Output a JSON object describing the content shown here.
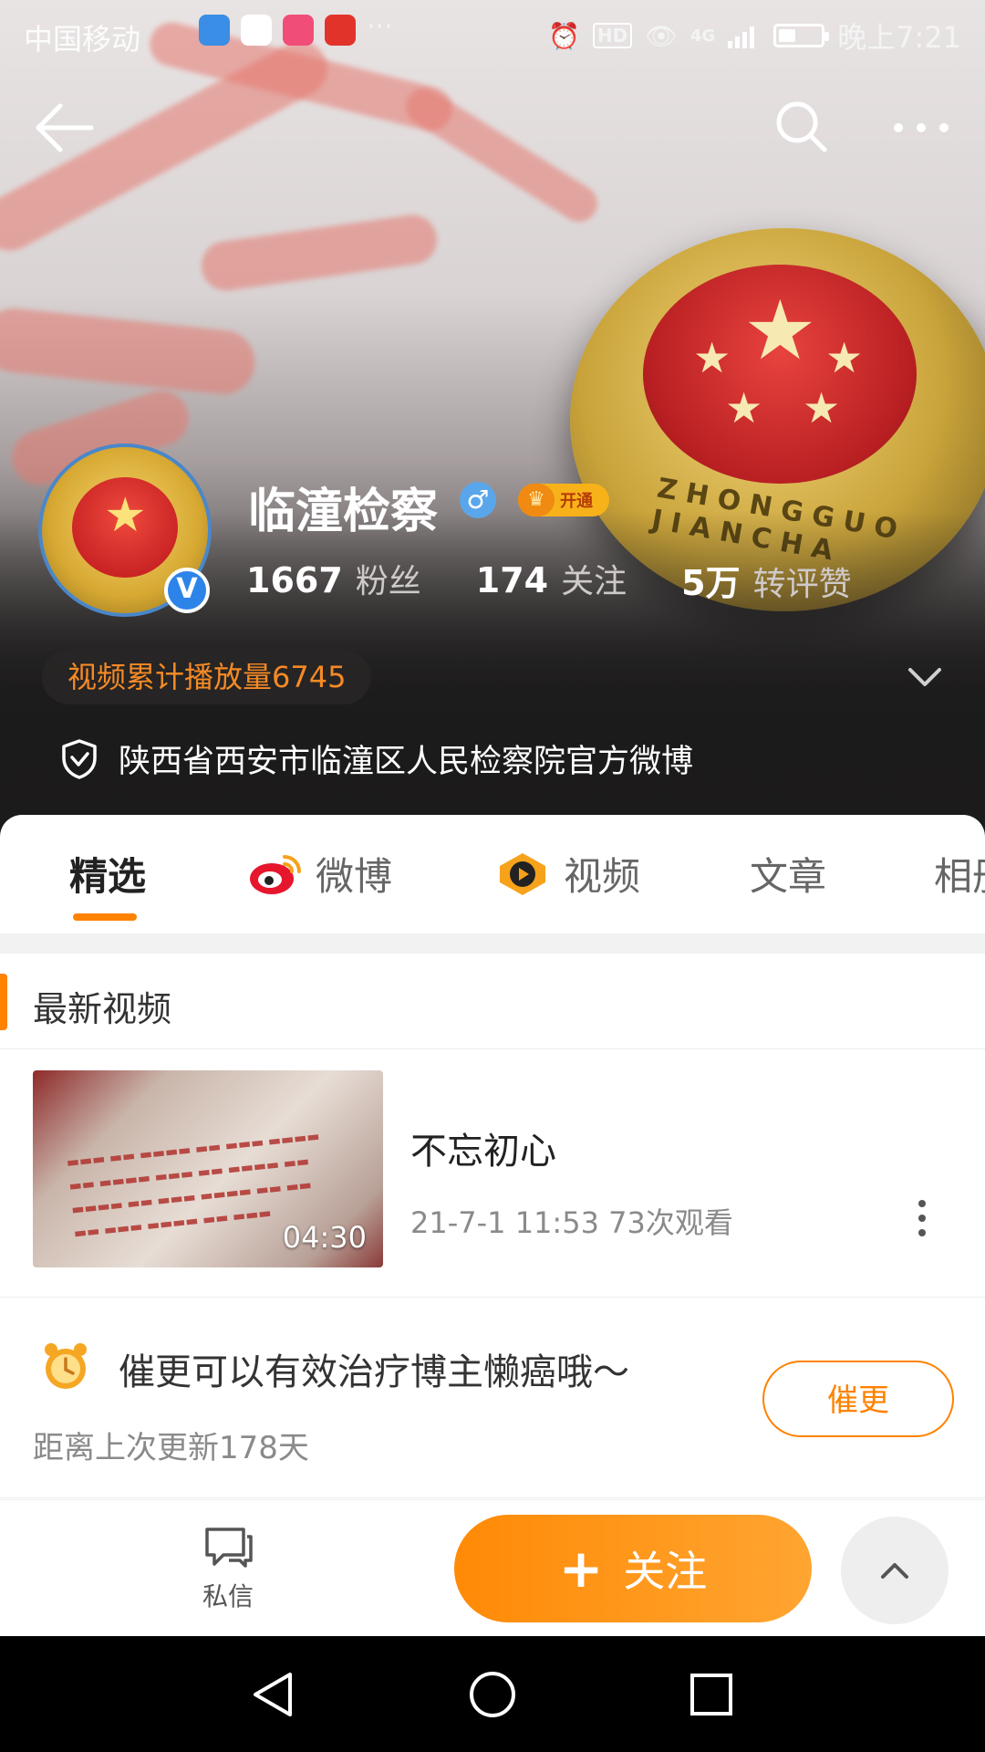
{
  "status_bar": {
    "carrier": "中国移动",
    "time": "晚上7:21",
    "network": "4G",
    "hd": "HD",
    "app_icon_colors": [
      "#3a8ee6",
      "#ffffff",
      "#f04d79",
      "#e2332a"
    ]
  },
  "top_nav": {
    "back_icon": "arrow-left-icon",
    "search_icon": "search-icon",
    "more_icon": "more-dots-icon"
  },
  "profile": {
    "name": "临潼检察",
    "gender_symbol": "♂",
    "verified_symbol": "V",
    "vip_label": "开通",
    "stats": [
      {
        "num": "1667",
        "label": "粉丝"
      },
      {
        "num": "174",
        "label": "关注"
      },
      {
        "num": "5万",
        "label": "转评赞"
      }
    ],
    "play_count": "视频累计播放量6745",
    "intro": "陕西省西安市临潼区人民检察院官方微博"
  },
  "tabs": [
    {
      "label": "精选",
      "active": true
    },
    {
      "label": "微博",
      "active": false
    },
    {
      "label": "视频",
      "active": false
    },
    {
      "label": "文章",
      "active": false
    },
    {
      "label": "相册",
      "active": false
    }
  ],
  "section": {
    "title": "最新视频"
  },
  "video": {
    "title": "不忘初心",
    "meta": "21-7-1 11:53 73次观看",
    "duration": "04:30"
  },
  "nudge": {
    "title": "催更可以有效治疗博主懒癌哦～",
    "subtitle": "距离上次更新178天",
    "button": "催更"
  },
  "bottom_bar": {
    "dm_label": "私信",
    "follow_plus": "+",
    "follow_label": "关注"
  },
  "colors": {
    "accent": "#ff8200",
    "verified_blue": "#2d84e8",
    "play_count_orange": "#f58a25"
  }
}
